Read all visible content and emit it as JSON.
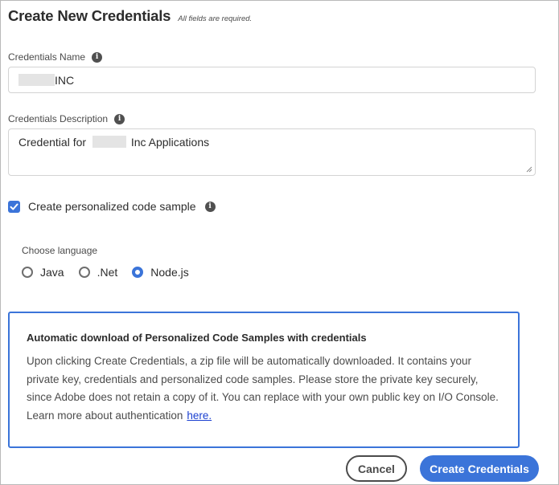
{
  "header": {
    "title": "Create New Credentials",
    "subtitle": "All fields are required."
  },
  "credentials_name": {
    "label": "Credentials Name",
    "value_suffix": "INC"
  },
  "credentials_description": {
    "label": "Credentials Description",
    "value_prefix": "Credential for",
    "value_suffix": "Inc Applications"
  },
  "code_sample": {
    "label": "Create personalized code sample",
    "checked": true
  },
  "language": {
    "label": "Choose language",
    "options": [
      "Java",
      ".Net",
      "Node.js"
    ],
    "selected": "Node.js"
  },
  "notice": {
    "title": "Automatic download of Personalized Code Samples with credentials",
    "body": "Upon clicking Create Credentials, a zip file will be automatically downloaded. It contains your private key, credentials and personalized code samples. Please store the private key securely, since Adobe does not retain a copy of it. You can replace with your own public key on I/O Console. Learn more about authentication",
    "link_label": "here."
  },
  "actions": {
    "cancel_label": "Cancel",
    "create_label": "Create Credentials"
  },
  "icons": {
    "info": "info-icon",
    "checkmark": "checkmark-icon",
    "resize": "resize-grip-icon"
  },
  "colors": {
    "accent": "#3b74d9",
    "link": "#1a3fd0",
    "text": "#2c2c2c"
  }
}
